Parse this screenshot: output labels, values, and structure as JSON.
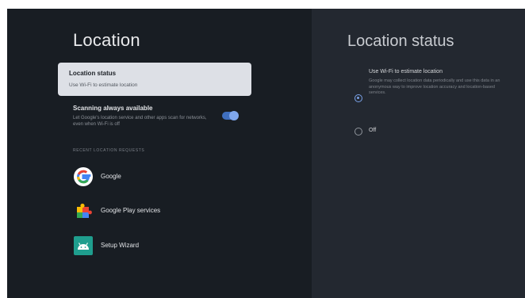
{
  "left": {
    "title": "Location",
    "card": {
      "title": "Location status",
      "subtitle": "Use Wi-Fi to estimate location"
    },
    "scanning": {
      "title": "Scanning always available",
      "description": "Let Google's location service and other apps scan for networks, even when Wi-Fi is off",
      "enabled": true
    },
    "section_header": "RECENT LOCATION REQUESTS",
    "apps": [
      {
        "label": "Google",
        "icon": "google-g-icon"
      },
      {
        "label": "Google Play services",
        "icon": "puzzle-piece-icon"
      },
      {
        "label": "Setup Wizard",
        "icon": "android-icon"
      }
    ]
  },
  "right": {
    "title": "Location status",
    "options": [
      {
        "title": "Use Wi-Fi to estimate location",
        "description": "Google may collect location data periodically and use this data in an anonymous way to improve location accuracy and location-based services.",
        "selected": true
      },
      {
        "title": "Off",
        "selected": false
      }
    ]
  },
  "colors": {
    "accent": "#7aa2e8",
    "toggle_track": "#3f6fbf",
    "background": "#181d23"
  }
}
